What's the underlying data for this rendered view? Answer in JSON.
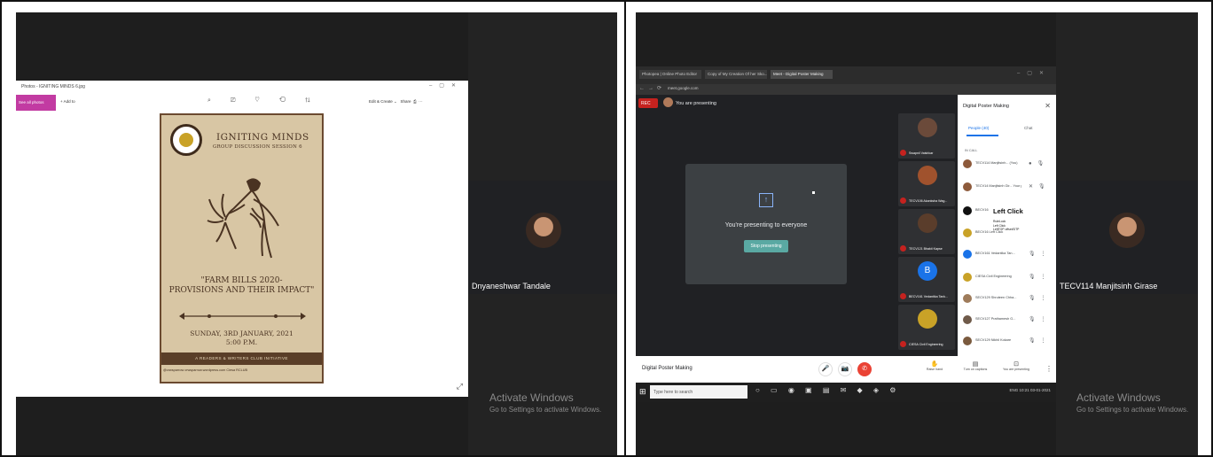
{
  "left_panel": {
    "photos": {
      "title": "Photos - IGNITING MINDS 6.jpg",
      "see_all_photos": "See all photos",
      "add_to": "+ Add to",
      "tool_icons": "⌕ ⎚ ♡ ⟲ ⇅",
      "edit_create": "Edit & Create",
      "share": "Share",
      "expand_icon": "expand-icon"
    },
    "poster": {
      "title": "IGNITING MINDS",
      "subtitle": "GROUP DISCUSSION SESSION 6",
      "topic_line1": "\"FARM BILLS 2020-",
      "topic_line2": "PROVISIONS AND THEIR IMPACT\"",
      "date": "SUNDAY, 3RD JANUARY, 2021",
      "time": "5:00 P.M.",
      "band": "A READERS & WRITERS CLUB INITIATIVE",
      "footer": "@crwsparrow  crwsparrow.wordpress.com  Ciesa RCLUB"
    },
    "video_tile": {
      "name": "Dnyaneshwar Tandale"
    },
    "activate": {
      "line1": "Activate Windows",
      "line2": "Go to Settings to activate Windows."
    }
  },
  "right_panel": {
    "browser": {
      "tabs": [
        "Photopea | Online Photo Editor",
        "Copy of My Creation Of her Sko...",
        "Meet - Digital Poster Making"
      ],
      "url": "meet.google.com"
    },
    "meet": {
      "rec": "REC",
      "presenting_label": "You are presenting",
      "share_message": "You're presenting to everyone",
      "stop_button": "Stop presenting",
      "thumbnails": [
        {
          "name": "Swapnil Vaishkar",
          "color": "#6b4a3a"
        },
        {
          "name": "TECV106 Akanksha Wag...",
          "color": "#a0522d"
        },
        {
          "name": "TECV121 Bhakti Kapse",
          "color": "#5a3d2b"
        },
        {
          "name": "BECV161 Vedantika Tank...",
          "color": "#1a73e8",
          "initial": "B"
        },
        {
          "name": "CIESA Civil Engineering",
          "color": "#c9a227"
        }
      ],
      "meeting_name": "Digital Poster Making",
      "controls": {
        "mic": "🎤",
        "cam": "📷",
        "end": "✆"
      },
      "right_buttons": [
        {
          "glyph": "✋",
          "label": "Raise hand"
        },
        {
          "glyph": "▤",
          "label": "Turn on captions"
        },
        {
          "glyph": "⊡",
          "label": "You are presenting"
        }
      ],
      "more": "⋮"
    },
    "people_panel": {
      "title": "Digital Poster Making",
      "people_tab": "People (40)",
      "chat_tab": "Chat",
      "in_call": "IN CALL",
      "people": [
        {
          "name": "TECV114 Manjitsinh... (You)",
          "color": "#8d5a3b"
        },
        {
          "name": "TECV14 Manjitsinh Gir... Your presentation",
          "color": "#8d5a3b"
        },
        {
          "name": "BECV16",
          "color": "#111111"
        },
        {
          "name": "BECV16 Left Click",
          "color": "#c9a227"
        },
        {
          "name": "BECV161 Vedantika Tan...",
          "color": "#1a73e8"
        },
        {
          "name": "CIESA Civil Engineering",
          "color": "#c9a227"
        },
        {
          "name": "SECV129 Shruteen Chha...",
          "color": "#9e7b5a"
        },
        {
          "name": "SECV127 Prathamesh G...",
          "color": "#6f5a4a"
        },
        {
          "name": "SECV129 Nikhil Kokare",
          "color": "#7a5a3e"
        }
      ],
      "tooltip_title": "Left Click",
      "tooltip_sub": "RuleLock\nLeft Click\nLeftTOP offset/DTP"
    },
    "taskbar": {
      "search": "Type here to search",
      "tray": "ENG 10:21 03-01-2021"
    },
    "video_tile": {
      "name": "TECV114 Manjitsinh Girase"
    },
    "activate": {
      "line1": "Activate Windows",
      "line2": "Go to Settings to activate Windows."
    }
  }
}
